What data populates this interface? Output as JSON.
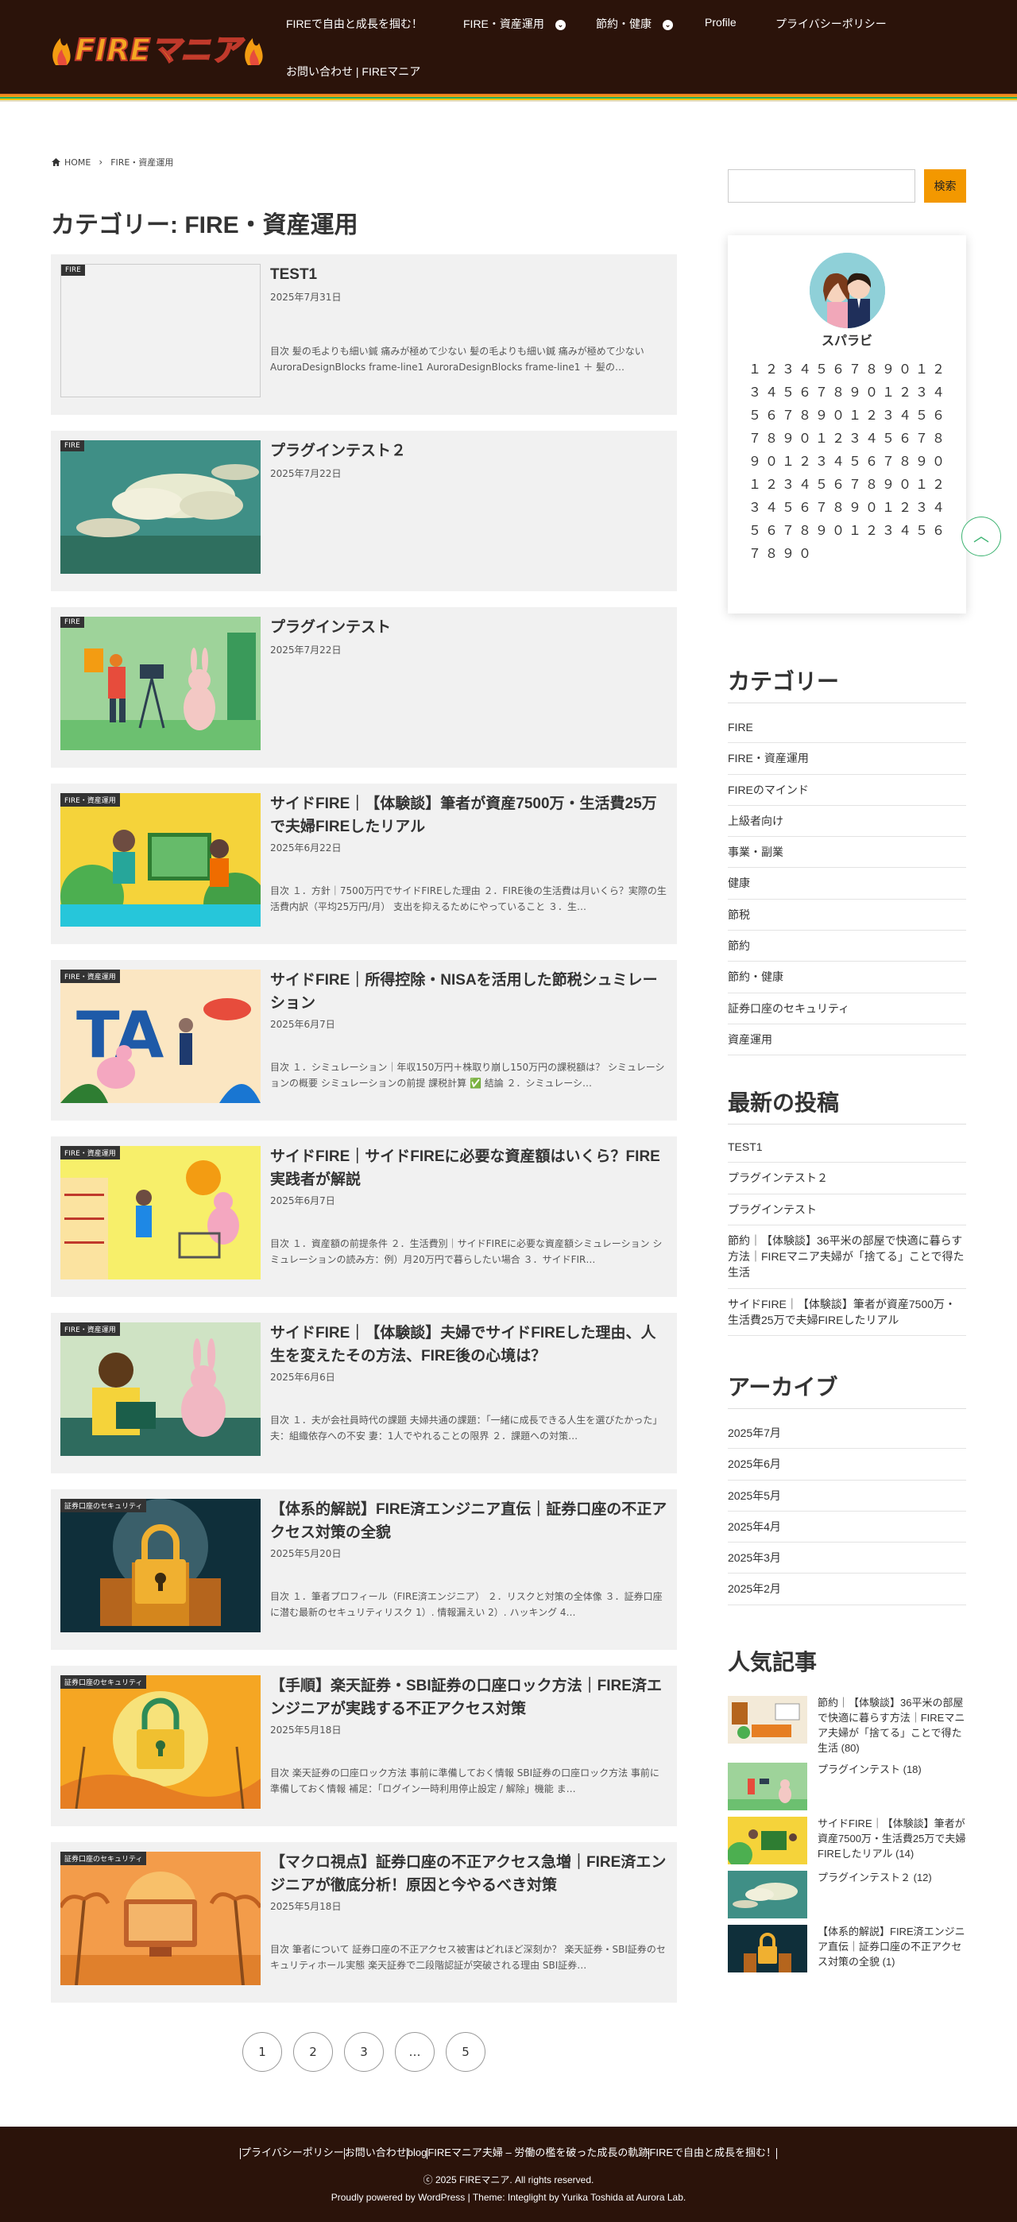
{
  "header": {
    "logo_text": "FIREマニア",
    "nav": [
      {
        "label": "FIREで自由と成長を掴む！"
      },
      {
        "label": "FIRE・資産運用"
      },
      {
        "label": "節約・健康"
      },
      {
        "label": "Profile"
      },
      {
        "label": "プライバシーポリシー"
      },
      {
        "label": "お問い合わせ | FIREマニア"
      }
    ],
    "stripe_colors": [
      "#e67e22",
      "#f39c12",
      "#27ae60",
      "#f1c40f",
      "#ddd"
    ]
  },
  "breadcrumb": {
    "home": "HOME",
    "current": "FIRE・資産運用"
  },
  "page_title": "カテゴリー: FIRE・資産運用",
  "posts": [
    {
      "badge": "FIRE",
      "title": "TEST1",
      "date": "2025年7月31日",
      "excerpt": "目次 髪の毛よりも細い鍼 痛みが極めて少ない 髪の毛よりも細い鍼 痛みが極めて少ないAuroraDesignBlocks frame-line1 AuroraDesignBlocks frame-line1 ＋ 髪の…"
    },
    {
      "badge": "FIRE",
      "title": "プラグインテスト２",
      "date": "2025年7月22日",
      "excerpt": ""
    },
    {
      "badge": "FIRE",
      "title": "プラグインテスト",
      "date": "2025年7月22日",
      "excerpt": ""
    },
    {
      "badge": "FIRE・資産運用",
      "title": "サイドFIRE｜【体験談】筆者が資産7500万・生活費25万で夫婦FIREしたリアル",
      "date": "2025年6月22日",
      "excerpt": "目次 １．方針｜7500万円でサイドFIREした理由 ２．FIRE後の生活費は月いくら？実際の生活費内訳（平均25万円/月） 支出を抑えるためにやっていること ３．生…"
    },
    {
      "badge": "FIRE・資産運用",
      "title": "サイドFIRE｜所得控除・NISAを活用した節税シュミレーション",
      "date": "2025年6月7日",
      "excerpt": "目次 １．シミュレーション｜年収150万円＋株取り崩し150万円の課税額は？ シミュレーションの概要 シミュレーションの前提 課税計算 ✅ 結論 ２．シミュレーシ…"
    },
    {
      "badge": "FIRE・資産運用",
      "title": "サイドFIRE｜サイドFIREに必要な資産額はいくら？FIRE実践者が解説",
      "date": "2025年6月7日",
      "excerpt": "目次 １．資産額の前提条件 ２．生活費別｜サイドFIREに必要な資産額シミュレーション シミュレーションの読み方：例）月20万円で暮らしたい場合 ３．サイドFIR…"
    },
    {
      "badge": "FIRE・資産運用",
      "title": "サイドFIRE｜【体験談】夫婦でサイドFIREした理由、人生を変えたその方法、FIRE後の心境は？",
      "date": "2025年6月6日",
      "excerpt": "目次 １．夫が会社員時代の課題 夫婦共通の課題：「一緒に成長できる人生を選びたかった」 夫：組織依存への不安 妻：1人でやれることの限界 ２．課題への対策…"
    },
    {
      "badge": "証券口座のセキュリティ",
      "title": "【体系的解説】FIRE済エンジニア直伝｜証券口座の不正アクセス対策の全貌",
      "date": "2025年5月20日",
      "excerpt": "目次 １．筆者プロフィール（FIRE済エンジニア） ２．リスクと対策の全体像 ３．証券口座に潜む最新のセキュリティリスク 1）. 情報漏えい 2）. ハッキング 4…"
    },
    {
      "badge": "証券口座のセキュリティ",
      "title": "【手順】楽天証券・SBI証券の口座ロック方法｜FIRE済エンジニアが実践する不正アクセス対策",
      "date": "2025年5月18日",
      "excerpt": "目次 楽天証券の口座ロック方法 事前に準備しておく情報 SBI証券の口座ロック方法 事前に準備しておく情報 補足：「ログイン一時利用停止設定 / 解除」機能 ま…"
    },
    {
      "badge": "証券口座のセキュリティ",
      "title": "【マクロ視点】証券口座の不正アクセス急増｜FIRE済エンジニアが徹底分析！原因と今やるべき対策",
      "date": "2025年5月18日",
      "excerpt": "目次 筆者について 証券口座の不正アクセス被害はどれほど深刻か？ 楽天証券・SBI証券のセキュリティホール実態 楽天証券で二段階認証が突破される理由 SBI証券…"
    }
  ],
  "pagination": [
    "1",
    "2",
    "3",
    "…",
    "5"
  ],
  "sidebar": {
    "search_button": "検索",
    "profile_name": "スパラビ",
    "profile_text": "１２３４５６７８９０１２３４５６７８９０１２３４５６７８９０１２３４５６７８９０１２３４５６７８９０１２３４５６７８９０１２３４５６７８９０１２３４５６７８９０１２３４５６７８９０１２３４５６７８９０",
    "categories_title": "カテゴリー",
    "categories": [
      "FIRE",
      "FIRE・資産運用",
      "FIREのマインド",
      "上級者向け",
      "事業・副業",
      "健康",
      "節税",
      "節約",
      "節約・健康",
      "証券口座のセキュリティ",
      "資産運用"
    ],
    "recent_title": "最新の投稿",
    "recent": [
      "TEST1",
      "プラグインテスト２",
      "プラグインテスト",
      "節約｜【体験談】36平米の部屋で快適に暮らす方法｜FIREマニア夫婦が「捨てる」ことで得た生活",
      "サイドFIRE｜【体験談】筆者が資産7500万・生活費25万で夫婦FIREしたリアル"
    ],
    "archive_title": "アーカイブ",
    "archives": [
      "2025年7月",
      "2025年6月",
      "2025年5月",
      "2025年4月",
      "2025年3月",
      "2025年2月"
    ],
    "popular_title": "人気記事",
    "popular": [
      {
        "text": "節約｜【体験談】36平米の部屋で快適に暮らす方法｜FIREマニア夫婦が「捨てる」ことで得た生活 (80)"
      },
      {
        "text": "プラグインテスト (18)"
      },
      {
        "text": "サイドFIRE｜【体験談】筆者が資産7500万・生活費25万で夫婦FIREしたリアル (14)"
      },
      {
        "text": "プラグインテスト２ (12)"
      },
      {
        "text": "【体系的解説】FIRE済エンジニア直伝｜証券口座の不正アクセス対策の全貌 (1)"
      }
    ]
  },
  "footer": {
    "links": [
      "プライバシーポリシー",
      "お問い合わせ",
      "blog",
      "FIREマニア夫婦 – 労働の檻を破った成長の軌跡",
      "FIREで自由と成長を掴む！"
    ],
    "copyright": "ⓒ 2025 FIREマニア. All rights reserved.",
    "powered": "Proudly powered by WordPress | Theme: Integlight by Yurika Toshida at Aurora Lab."
  }
}
